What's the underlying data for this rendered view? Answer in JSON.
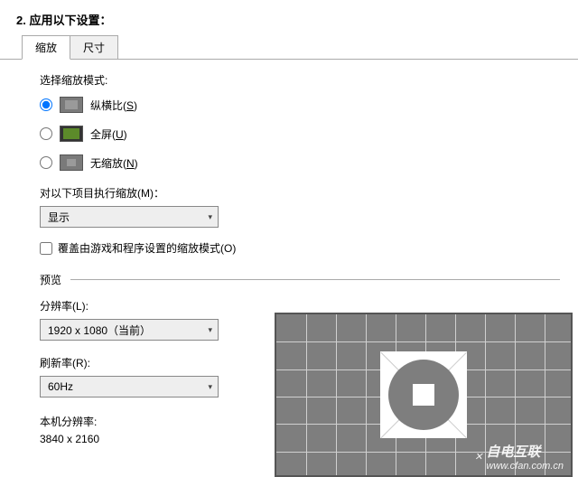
{
  "header": "2.  应用以下设置：",
  "tabs": {
    "t0": "缩放",
    "t1": "尺寸"
  },
  "mode_label": "选择缩放模式:",
  "radios": {
    "r0": "纵横比(<u>S</u>)",
    "r1": "全屏(<u>U</u>)",
    "r2": "无缩放(<u>N</u>)"
  },
  "perform_label": "对以下项目执行缩放(M)：",
  "perform_value": "显示",
  "override_label": "覆盖由游戏和程序设置的缩放模式(O)",
  "preview_label": "预览",
  "res_label": "分辨率(L):",
  "res_value": "1920 x 1080（当前）",
  "refresh_label": "刷新率(R):",
  "refresh_value": "60Hz",
  "native_label": "本机分辨率:",
  "native_value": "3840 x 2160",
  "watermark": {
    "main": "自电互联",
    "sub": "www.cfan.com.cn"
  }
}
